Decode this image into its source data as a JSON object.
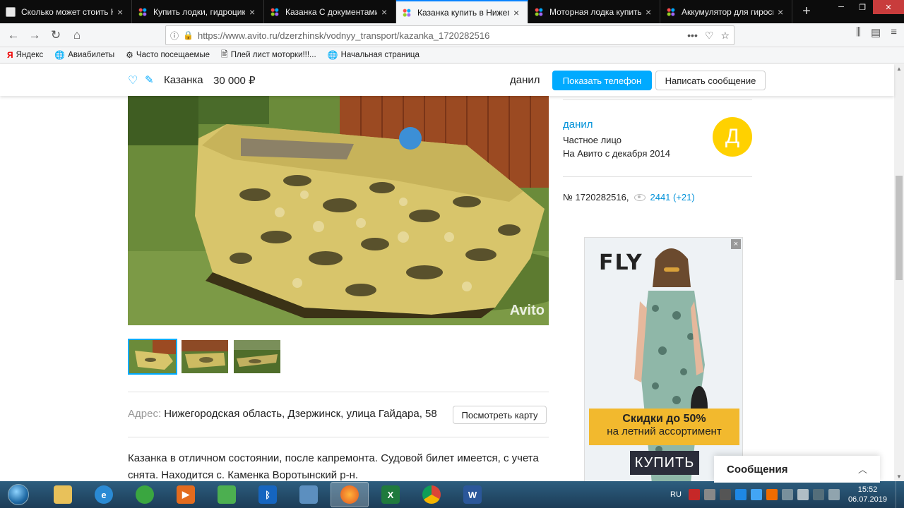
{
  "tabs": [
    {
      "title": "Сколько может стоить Ка",
      "icon": "doc"
    },
    {
      "title": "Купить лодки, гидроцикл",
      "icon": "avito"
    },
    {
      "title": "Казанка С документами в",
      "icon": "avito"
    },
    {
      "title": "Казанка купить в Нижего",
      "icon": "avito",
      "active": true
    },
    {
      "title": "Моторная лодка купить в",
      "icon": "avito"
    },
    {
      "title": "Аккумулятор для гироск",
      "icon": "avito"
    }
  ],
  "browser": {
    "url": "https://www.avito.ru/dzerzhinsk/vodnyy_transport/kazanka_1720282516"
  },
  "bookmarks": [
    {
      "label": "Яндекс",
      "icon": "Я"
    },
    {
      "label": "Авиабилеты",
      "icon": "🌐"
    },
    {
      "label": "Часто посещаемые",
      "icon": "⚙"
    },
    {
      "label": "Плей лист моторки!!!...",
      "icon": "🖹"
    },
    {
      "label": "Начальная страница",
      "icon": "🌐"
    }
  ],
  "listing": {
    "title": "Казанка",
    "price": "30 000 ₽",
    "seller": "данил",
    "show_phone": "Показать телефон",
    "write_message": "Написать сообщение",
    "address_label": "Адрес:",
    "address": "Нижегородская область, Дзержинск, улица Гайдара, 58",
    "map_button": "Посмотреть карту",
    "description": "Казанка в отличном состоянии, после капремонта. Судовой билет имеется, с учета снята. Находится с. Каменка Воротынский р-н.",
    "photo_watermark": "Avito",
    "thumbnail_count": 3
  },
  "seller_box": {
    "name": "данил",
    "type": "Частное лицо",
    "since": "На Авито с декабря 2014",
    "avatar_letter": "Д",
    "avatar_color": "#ffd100"
  },
  "stats": {
    "id": "№ 1720282516,",
    "views": "2441 (+21)"
  },
  "ad": {
    "brand": "FLY",
    "line1": "Скидки до 50%",
    "line2": "на летний ассортимент",
    "button": "КУПИТЬ",
    "close": "×"
  },
  "messages_panel": {
    "label": "Сообщения"
  },
  "taskbar": {
    "lang": "RU",
    "time": "15:52",
    "date": "06.07.2019"
  },
  "colors": {
    "accent": "#00aaff",
    "link": "#0091d9"
  }
}
